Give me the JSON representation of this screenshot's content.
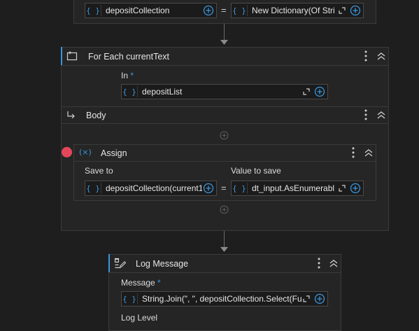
{
  "top_assign": {
    "to_value": "depositCollection",
    "value": "New Dictionary(Of Stri"
  },
  "for_each": {
    "title": "For Each currentText",
    "in_label": "In",
    "required_mark": "*",
    "in_value": "depositList",
    "body_label": "Body"
  },
  "assign": {
    "title": "Assign",
    "save_to_label": "Save to",
    "value_label": "Value to save",
    "save_to_value": "depositCollection(current1",
    "value_to_save": "dt_input.AsEnumerabl",
    "equals": "="
  },
  "log_message": {
    "title": "Log Message",
    "message_label": "Message",
    "required_mark": "*",
    "message_value": "String.Join(\", \", depositCollection.Select(Fu",
    "log_level_label": "Log Level"
  },
  "icons": {
    "brace": "{ }",
    "variable": "(×)"
  },
  "colors": {
    "accent": "#3a96dd",
    "breakpoint": "#e5475a",
    "background": "#1e1e1e",
    "card": "#252526"
  }
}
